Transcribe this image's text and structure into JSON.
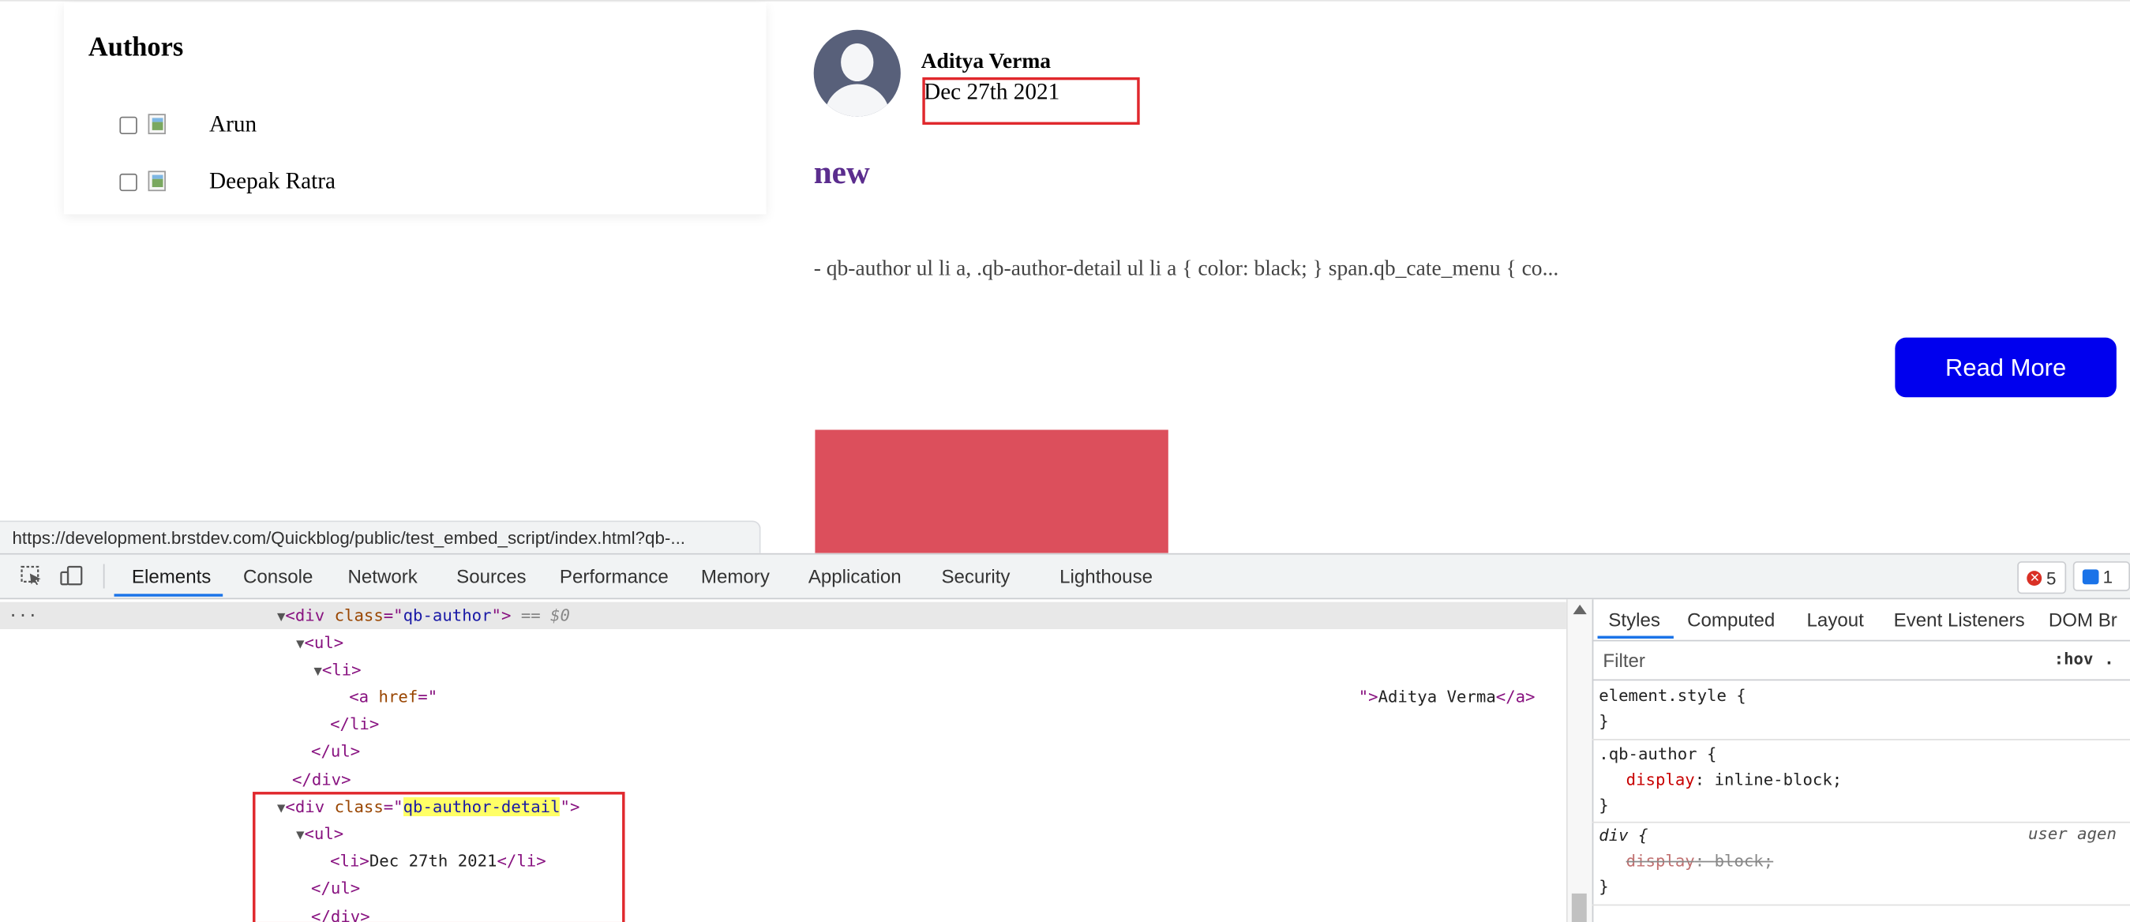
{
  "page": {
    "authors_title": "Authors",
    "authors": [
      {
        "name": "Arun"
      },
      {
        "name": "Deepak Ratra"
      }
    ],
    "post": {
      "author": "Aditya Verma",
      "date": "Dec 27th 2021",
      "title": "new",
      "excerpt": "- qb-author ul li a, .qb-author-detail ul li a { color: black; } span.qb_cate_menu { co...",
      "read_more": "Read More"
    },
    "status_url": "https://development.brstdev.com/Quickblog/public/test_embed_script/index.html?qb-..."
  },
  "colors": {
    "read_more_bg": "#0000ee",
    "post_image": "#dc4f5c",
    "highlight_box": "#e0282d",
    "post_title": "#5b2d8e"
  },
  "devtools": {
    "tabs": [
      "Elements",
      "Console",
      "Network",
      "Sources",
      "Performance",
      "Memory",
      "Application",
      "Security",
      "Lighthouse"
    ],
    "active_tab": "Elements",
    "error_count": "5",
    "message_count": "1",
    "dom": {
      "l1_tag": "<div",
      "l1_attr": "class",
      "l1_val": "qb-author",
      "l1_marker": "== $0",
      "l2": "<ul>",
      "l3": "<li>",
      "l4_tag": "<a",
      "l4_attr": "href",
      "l4_eq": "=\"",
      "l4_close": "\">",
      "l4_text": "Aditya Verma",
      "l4_end": "</a>",
      "l5": "</li>",
      "l6": "</ul>",
      "l7": "</div>",
      "l8_tag": "<div",
      "l8_attr": "class",
      "l8_val": "qb-author-detail",
      "l9": "<ul>",
      "l10_open": "<li>",
      "l10_text": "Dec 27th 2021",
      "l10_close": "</li>",
      "l11": "</ul>",
      "l12": "</div>"
    },
    "styles": {
      "tabs": [
        "Styles",
        "Computed",
        "Layout",
        "Event Listeners",
        "DOM Br"
      ],
      "filter_placeholder": "Filter",
      "hov": ":hov",
      "hov_dot": ".",
      "rule1_sel": "element.style {",
      "brace_close": "}",
      "rule2_sel": ".qb-author {",
      "rule2_prop": "display",
      "rule2_val": "inline-block;",
      "rule3_sel": "div {",
      "rule3_origin": "user agen",
      "rule3_prop": "display",
      "rule3_val": "block;"
    }
  }
}
